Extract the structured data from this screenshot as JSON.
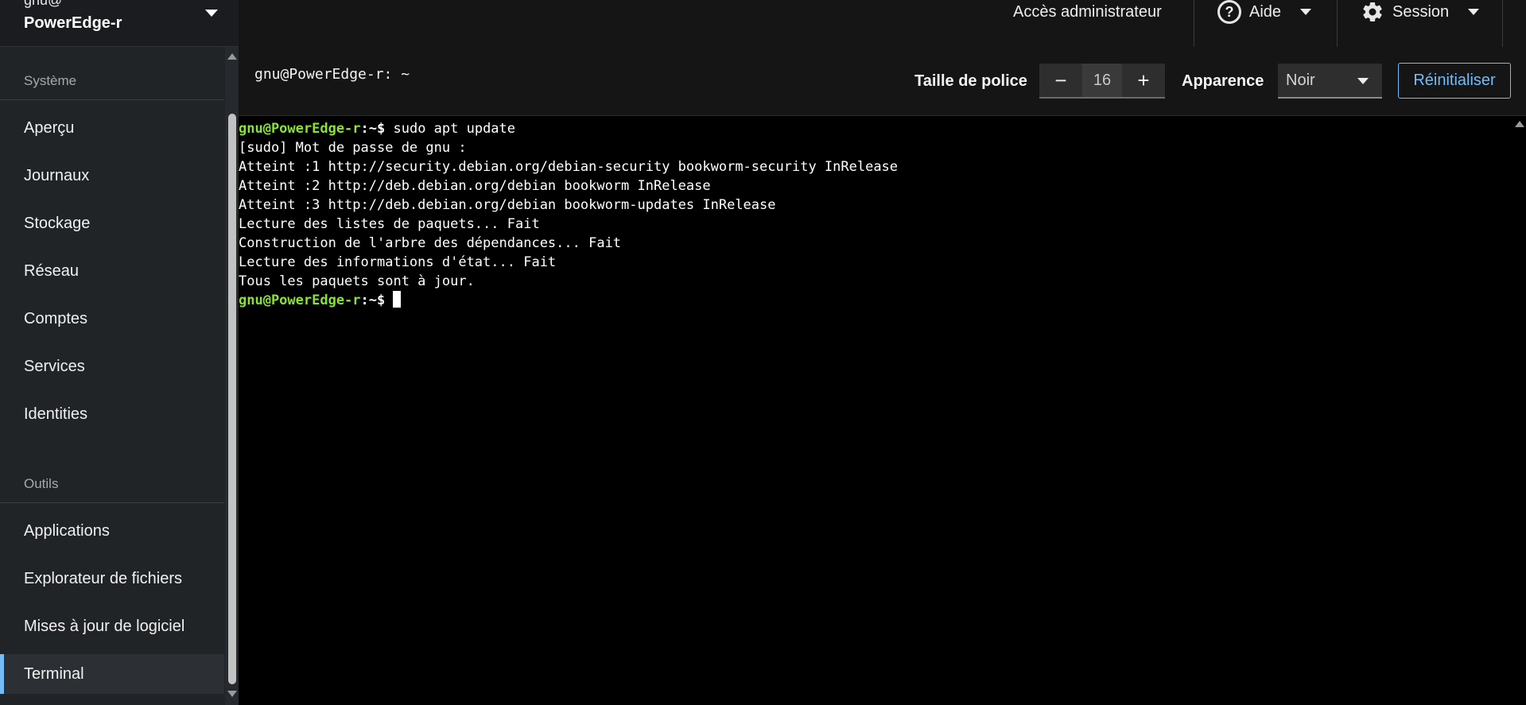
{
  "host": {
    "user": "gnu@",
    "name": "PowerEdge-r"
  },
  "nav": {
    "system_title": "Système",
    "system_items": [
      "Aperçu",
      "Journaux",
      "Stockage",
      "Réseau",
      "Comptes",
      "Services",
      "Identities"
    ],
    "tools_title": "Outils",
    "tools_items": [
      "Applications",
      "Explorateur de fichiers",
      "Mises à jour de logiciel",
      "Terminal"
    ],
    "active": "Terminal"
  },
  "topbar": {
    "admin_access": "Accès administrateur",
    "help": "Aide",
    "session": "Session"
  },
  "terminal_header": {
    "title": "gnu@PowerEdge-r: ~",
    "font_size_label": "Taille de police",
    "font_size_value": "16",
    "decrease": "−",
    "increase": "+",
    "appearance_label": "Apparence",
    "appearance_value": "Noir",
    "reset_label": "Réinitialiser"
  },
  "terminal": {
    "prompt_user": "gnu@PowerEdge-r",
    "prompt_path": ":~$ ",
    "command": "sudo apt update",
    "output": [
      "[sudo] Mot de passe de gnu :",
      "Atteint :1 http://security.debian.org/debian-security bookworm-security InRelease",
      "Atteint :2 http://deb.debian.org/debian bookworm InRelease",
      "Atteint :3 http://deb.debian.org/debian bookworm-updates InRelease",
      "Lecture des listes de paquets... Fait",
      "Construction de l'arbre des dépendances... Fait",
      "Lecture des informations d'état... Fait",
      "Tous les paquets sont à jour."
    ]
  },
  "colors": {
    "accent": "#73bcf7",
    "prompt_green": "#8ae234",
    "terminal_bg": "#000000"
  }
}
